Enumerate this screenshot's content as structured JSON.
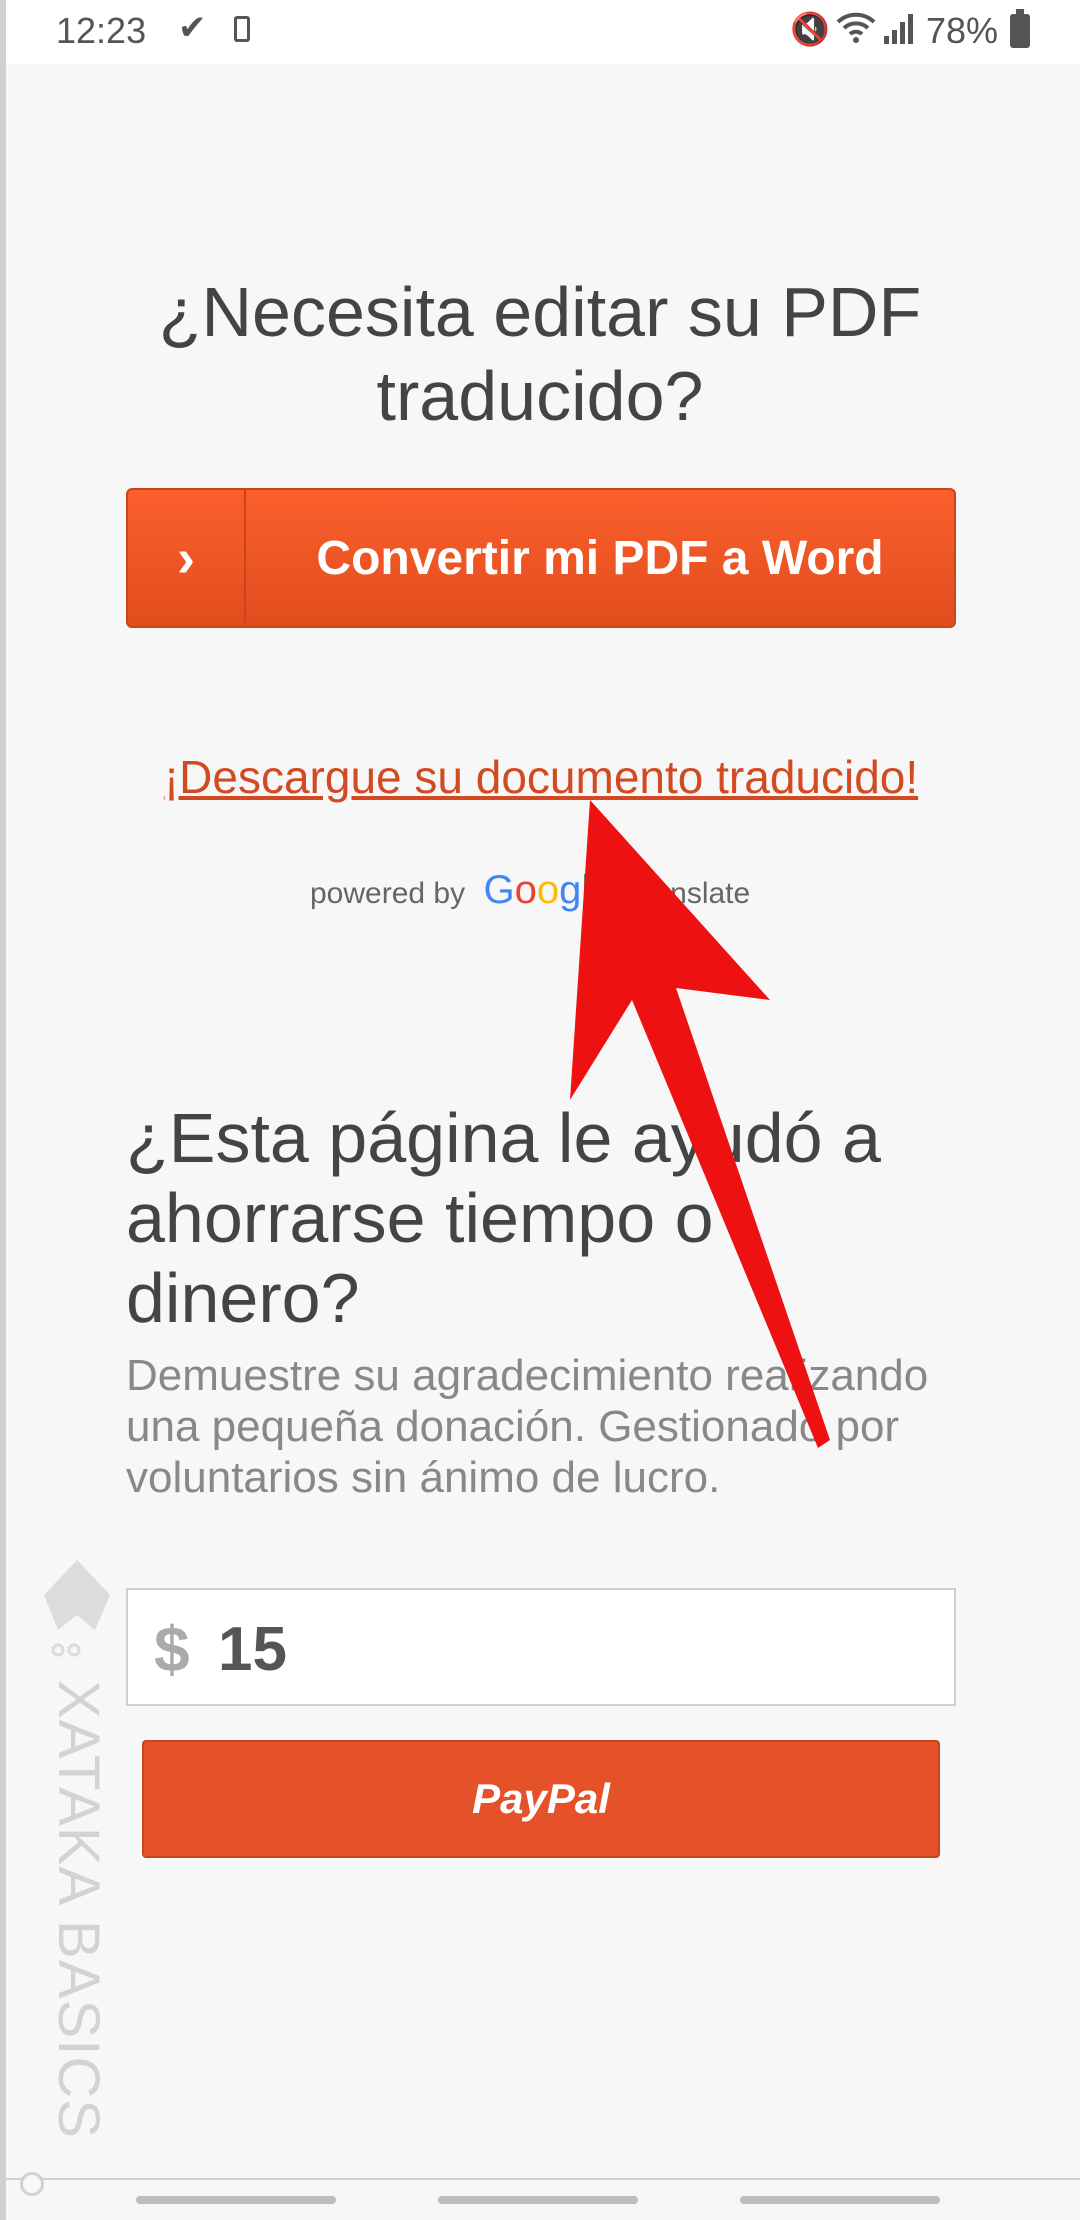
{
  "status_bar": {
    "time": "12:23",
    "battery": "78%"
  },
  "main": {
    "heading": "¿Necesita editar su PDF traducido?",
    "convert_button": "Convertir mi PDF a Word",
    "download_link": "¡Descargue su documento traducido!",
    "powered_by": "powered by",
    "google": [
      "G",
      "o",
      "o",
      "g",
      "l",
      "e"
    ],
    "translate": "Translate"
  },
  "donation": {
    "heading": "¿Esta página le ayudó a ahorrarse tiempo o dinero?",
    "description": "Demuestre su agradecimiento realizando una pequeña donación. Gestionado por voluntarios sin ánimo de lucro.",
    "currency": "$",
    "amount": "15",
    "paypal_button": "PayPal"
  },
  "watermark": "XATAKA BASICS",
  "colors": {
    "accent": "#e55129",
    "link": "#d24a22",
    "arrow": "#ee1111"
  }
}
